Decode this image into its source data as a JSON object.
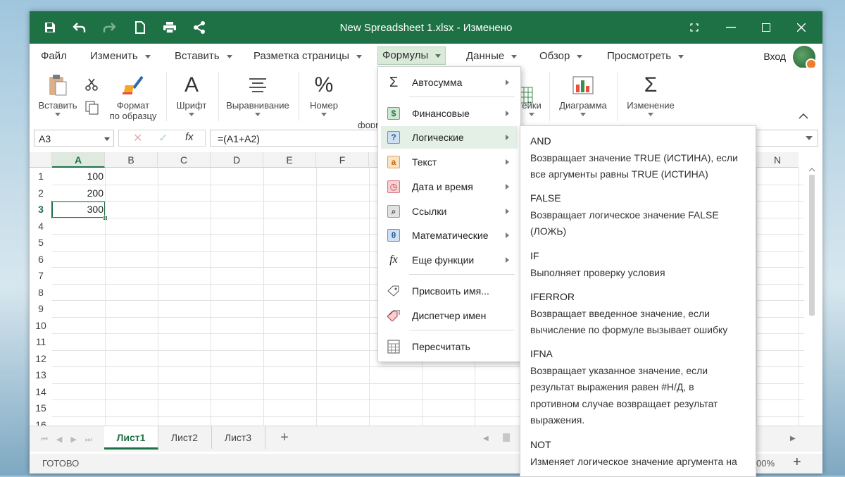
{
  "window": {
    "title": "New Spreadsheet 1.xlsx - Изменено"
  },
  "menubar": {
    "items": [
      "Файл",
      "Изменить",
      "Вставить",
      "Разметка страницы",
      "Формулы",
      "Данные",
      "Обзор",
      "Просмотреть"
    ],
    "login": "Вход"
  },
  "ribbon": {
    "paste": "Вставить",
    "format_painter": [
      "Формат",
      "по образцу"
    ],
    "font": "Шрифт",
    "align": "Выравнивание",
    "number": "Номер",
    "formula_partial": "форм",
    "cells_partial": "ейки",
    "chart": "Диаграмма",
    "edit": "Изменение"
  },
  "formulabar": {
    "namebox": "A3",
    "fx": "fx",
    "formula": "=(A1+A2)"
  },
  "grid": {
    "columns": [
      "A",
      "B",
      "C",
      "D",
      "E",
      "F",
      "N"
    ],
    "rows": [
      "1",
      "2",
      "3",
      "4",
      "5",
      "6",
      "7",
      "8",
      "9",
      "10",
      "11",
      "12",
      "13",
      "14",
      "15",
      "16"
    ],
    "cells": {
      "A1": "100",
      "A2": "200",
      "A3": "300"
    }
  },
  "sheets": {
    "tabs": [
      "Лист1",
      "Лист2",
      "Лист3"
    ],
    "add": "+"
  },
  "status": {
    "text": "ГОТОВО",
    "zoom": "00%",
    "zoom_plus": "+"
  },
  "formulas_menu": {
    "items": [
      {
        "label": "Автосумма",
        "icon": "sigma-icon"
      },
      {
        "label": "Финансовые",
        "icon": "dollar-icon"
      },
      {
        "label": "Логические",
        "icon": "question-icon"
      },
      {
        "label": "Текст",
        "icon": "text-a-icon"
      },
      {
        "label": "Дата и время",
        "icon": "clock-icon"
      },
      {
        "label": "Ссылки",
        "icon": "lookup-icon"
      },
      {
        "label": "Математические",
        "icon": "theta-icon"
      },
      {
        "label": "Еще функции",
        "icon": "fx-icon"
      },
      {
        "label": "Присвоить имя...",
        "icon": "tag-icon"
      },
      {
        "label": "Диспетчер имен",
        "icon": "tags-icon"
      },
      {
        "label": "Пересчитать",
        "icon": "calculator-icon"
      }
    ]
  },
  "logical_submenu": {
    "functions": [
      {
        "name": "AND",
        "desc": [
          "Возвращает значение TRUE (ИСТИНА), если",
          "все аргументы равны TRUE (ИСТИНА)"
        ]
      },
      {
        "name": "FALSE",
        "desc": [
          "Возвращает логическое значение FALSE",
          "(ЛОЖЬ)"
        ]
      },
      {
        "name": "IF",
        "desc": [
          "Выполняет проверку условия"
        ]
      },
      {
        "name": "IFERROR",
        "desc": [
          "Возвращает введенное значение, если",
          "вычисление по формуле вызывает ошибку"
        ]
      },
      {
        "name": "IFNA",
        "desc": [
          "Возвращает указанное значение, если",
          "результат выражения равен #Н/Д, в",
          "противном случае возвращает результат",
          "выражения."
        ]
      },
      {
        "name": "NOT",
        "desc": [
          "Изменяет логическое значение аргумента на"
        ]
      }
    ]
  },
  "colors": {
    "accent": "#1e7145",
    "highlight": "#e4efe6"
  }
}
